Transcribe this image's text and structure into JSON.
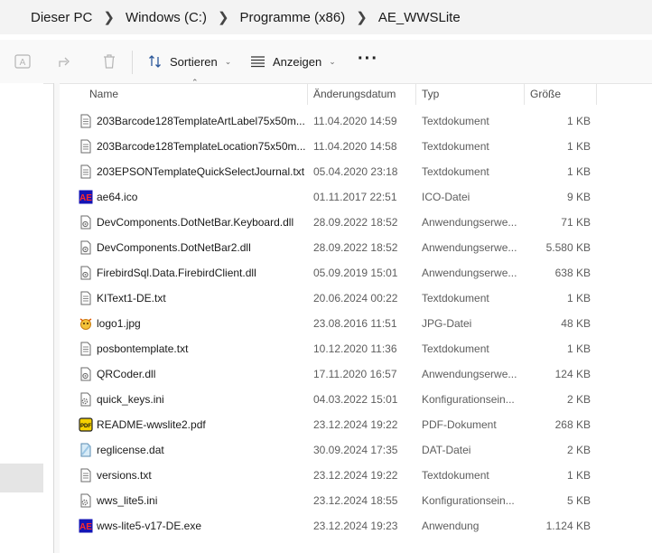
{
  "breadcrumb": [
    "Dieser PC",
    "Windows  (C:)",
    "Programme (x86)",
    "AE_WWSLite"
  ],
  "toolbar": {
    "sort_label": "Sortieren",
    "view_label": "Anzeigen"
  },
  "columns": {
    "name": "Name",
    "date": "Änderungsdatum",
    "type": "Typ",
    "size": "Größe"
  },
  "files": [
    {
      "name": "203Barcode128TemplateArtLabel75x50m...",
      "date": "11.04.2020 14:59",
      "type": "Textdokument",
      "size": "1 KB",
      "icon": "text-file-icon"
    },
    {
      "name": "203Barcode128TemplateLocation75x50m...",
      "date": "11.04.2020 14:58",
      "type": "Textdokument",
      "size": "1 KB",
      "icon": "text-file-icon"
    },
    {
      "name": "203EPSONTemplateQuickSelectJournal.txt",
      "date": "05.04.2020 23:18",
      "type": "Textdokument",
      "size": "1 KB",
      "icon": "text-file-icon"
    },
    {
      "name": "ae64.ico",
      "date": "01.11.2017 22:51",
      "type": "ICO-Datei",
      "size": "9 KB",
      "icon": "ae-app-icon"
    },
    {
      "name": "DevComponents.DotNetBar.Keyboard.dll",
      "date": "28.09.2022 18:52",
      "type": "Anwendungserwe...",
      "size": "71 KB",
      "icon": "dll-file-icon"
    },
    {
      "name": "DevComponents.DotNetBar2.dll",
      "date": "28.09.2022 18:52",
      "type": "Anwendungserwe...",
      "size": "5.580 KB",
      "icon": "dll-file-icon"
    },
    {
      "name": "FirebirdSql.Data.FirebirdClient.dll",
      "date": "05.09.2019 15:01",
      "type": "Anwendungserwe...",
      "size": "638 KB",
      "icon": "dll-file-icon"
    },
    {
      "name": "KIText1-DE.txt",
      "date": "20.06.2024 00:22",
      "type": "Textdokument",
      "size": "1 KB",
      "icon": "text-file-icon"
    },
    {
      "name": "logo1.jpg",
      "date": "23.08.2016 11:51",
      "type": "JPG-Datei",
      "size": "48 KB",
      "icon": "image-file-icon"
    },
    {
      "name": "posbontemplate.txt",
      "date": "10.12.2020 11:36",
      "type": "Textdokument",
      "size": "1 KB",
      "icon": "text-file-icon"
    },
    {
      "name": "QRCoder.dll",
      "date": "17.11.2020 16:57",
      "type": "Anwendungserwe...",
      "size": "124 KB",
      "icon": "dll-file-icon"
    },
    {
      "name": "quick_keys.ini",
      "date": "04.03.2022 15:01",
      "type": "Konfigurationsein...",
      "size": "2 KB",
      "icon": "ini-file-icon"
    },
    {
      "name": "README-wwslite2.pdf",
      "date": "23.12.2024 19:22",
      "type": "PDF-Dokument",
      "size": "268 KB",
      "icon": "pdf-file-icon"
    },
    {
      "name": "reglicense.dat",
      "date": "30.09.2024 17:35",
      "type": "DAT-Datei",
      "size": "2 KB",
      "icon": "dat-file-icon"
    },
    {
      "name": "versions.txt",
      "date": "23.12.2024 19:22",
      "type": "Textdokument",
      "size": "1 KB",
      "icon": "text-file-icon"
    },
    {
      "name": "wws_lite5.ini",
      "date": "23.12.2024 18:55",
      "type": "Konfigurationsein...",
      "size": "5 KB",
      "icon": "ini-file-icon"
    },
    {
      "name": "wws-lite5-v17-DE.exe",
      "date": "23.12.2024 19:23",
      "type": "Anwendung",
      "size": "1.124 KB",
      "icon": "ae-app-icon"
    }
  ]
}
